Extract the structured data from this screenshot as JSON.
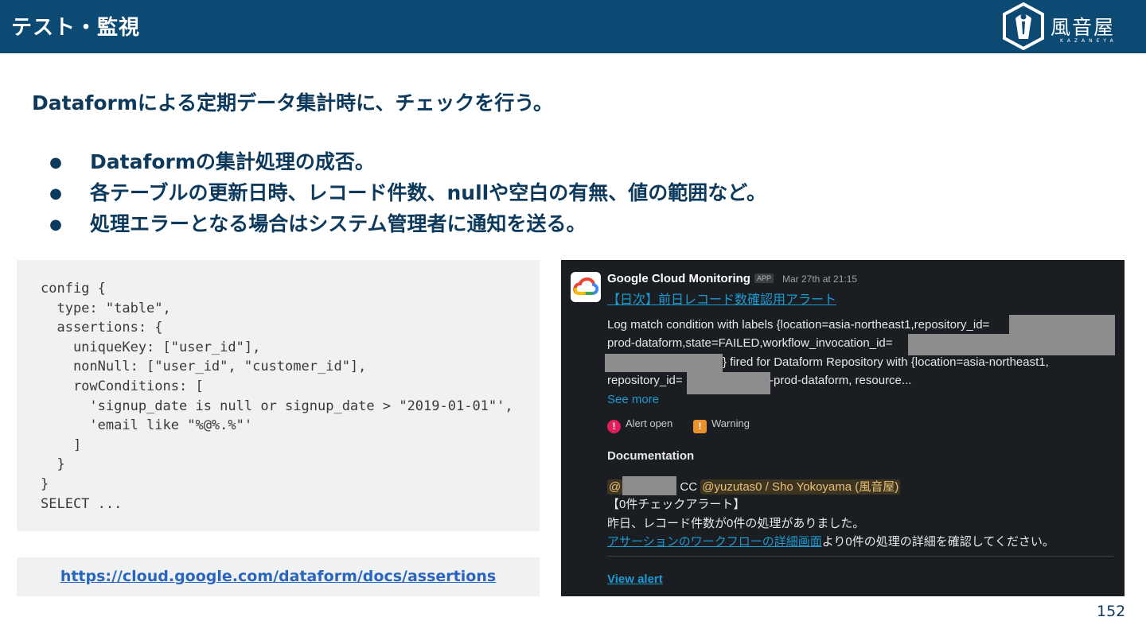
{
  "header": {
    "title": "テスト・監視",
    "logo_text": "風音屋",
    "logo_subtext": "KAZANEYA"
  },
  "lead": "Dataformによる定期データ集計時に、チェックを行う。",
  "bullets": [
    "Dataformの集計処理の成否。",
    "各テーブルの更新日時、レコード件数、nullや空白の有無、値の範囲など。",
    "処理エラーとなる場合はシステム管理者に通知を送る。"
  ],
  "bullet_marker": "●",
  "code_lines": [
    "config {",
    "  type: \"table\",",
    "  assertions: {",
    "    uniqueKey: [\"user_id\"],",
    "    nonNull: [\"user_id\", \"customer_id\"],",
    "    rowConditions: [",
    "      'signup_date is null or signup_date > \"2019-01-01\"',",
    "      'email like \"%@%.%\"'",
    "    ]",
    "  }",
    "}",
    "SELECT ..."
  ],
  "doc_link": "https://cloud.google.com/dataform/docs/assertions",
  "slack": {
    "sender": "Google Cloud Monitoring",
    "app_badge": "APP",
    "timestamp": "Mar 27th at 21:15",
    "alert_title": "【日次】前日レコード数確認用アラート",
    "body_line1": "Log match condition with labels {location=asia-northeast1,repository_id=",
    "body_line2": "prod-dataform,state=FAILED,workflow_invocation_id=",
    "body_line3": "} fired for Dataform Repository with {location=asia-northeast1,",
    "body_line4a": "repository_id=",
    "body_line4b": "-prod-dataform, resource...",
    "see_more": "See more",
    "status_open": "Alert open",
    "status_warning": "Warning",
    "doc_heading": "Documentation",
    "mention_prefix": "@",
    "cc": "CC",
    "cc_mention": "@yuzutas0 / Sho Yokoyama (風音屋)",
    "doc_line1": "【0件チェックアラート】",
    "doc_line2": "昨日、レコード件数が0件の処理がありました。",
    "doc_line3_link": "アサーションのワークフローの詳細画面",
    "doc_line3_rest": "より0件の処理の詳細を確認してください。",
    "view_alert": "View alert",
    "colors": {
      "background": "#1a1d21",
      "link": "#1d9bd1",
      "alert_red": "#e01e5a",
      "warning_orange": "#e8912d",
      "mention": "#e8c074"
    }
  },
  "page_number": "152",
  "colors": {
    "header_bg": "#0c4a74",
    "text": "#0d3a5c"
  }
}
